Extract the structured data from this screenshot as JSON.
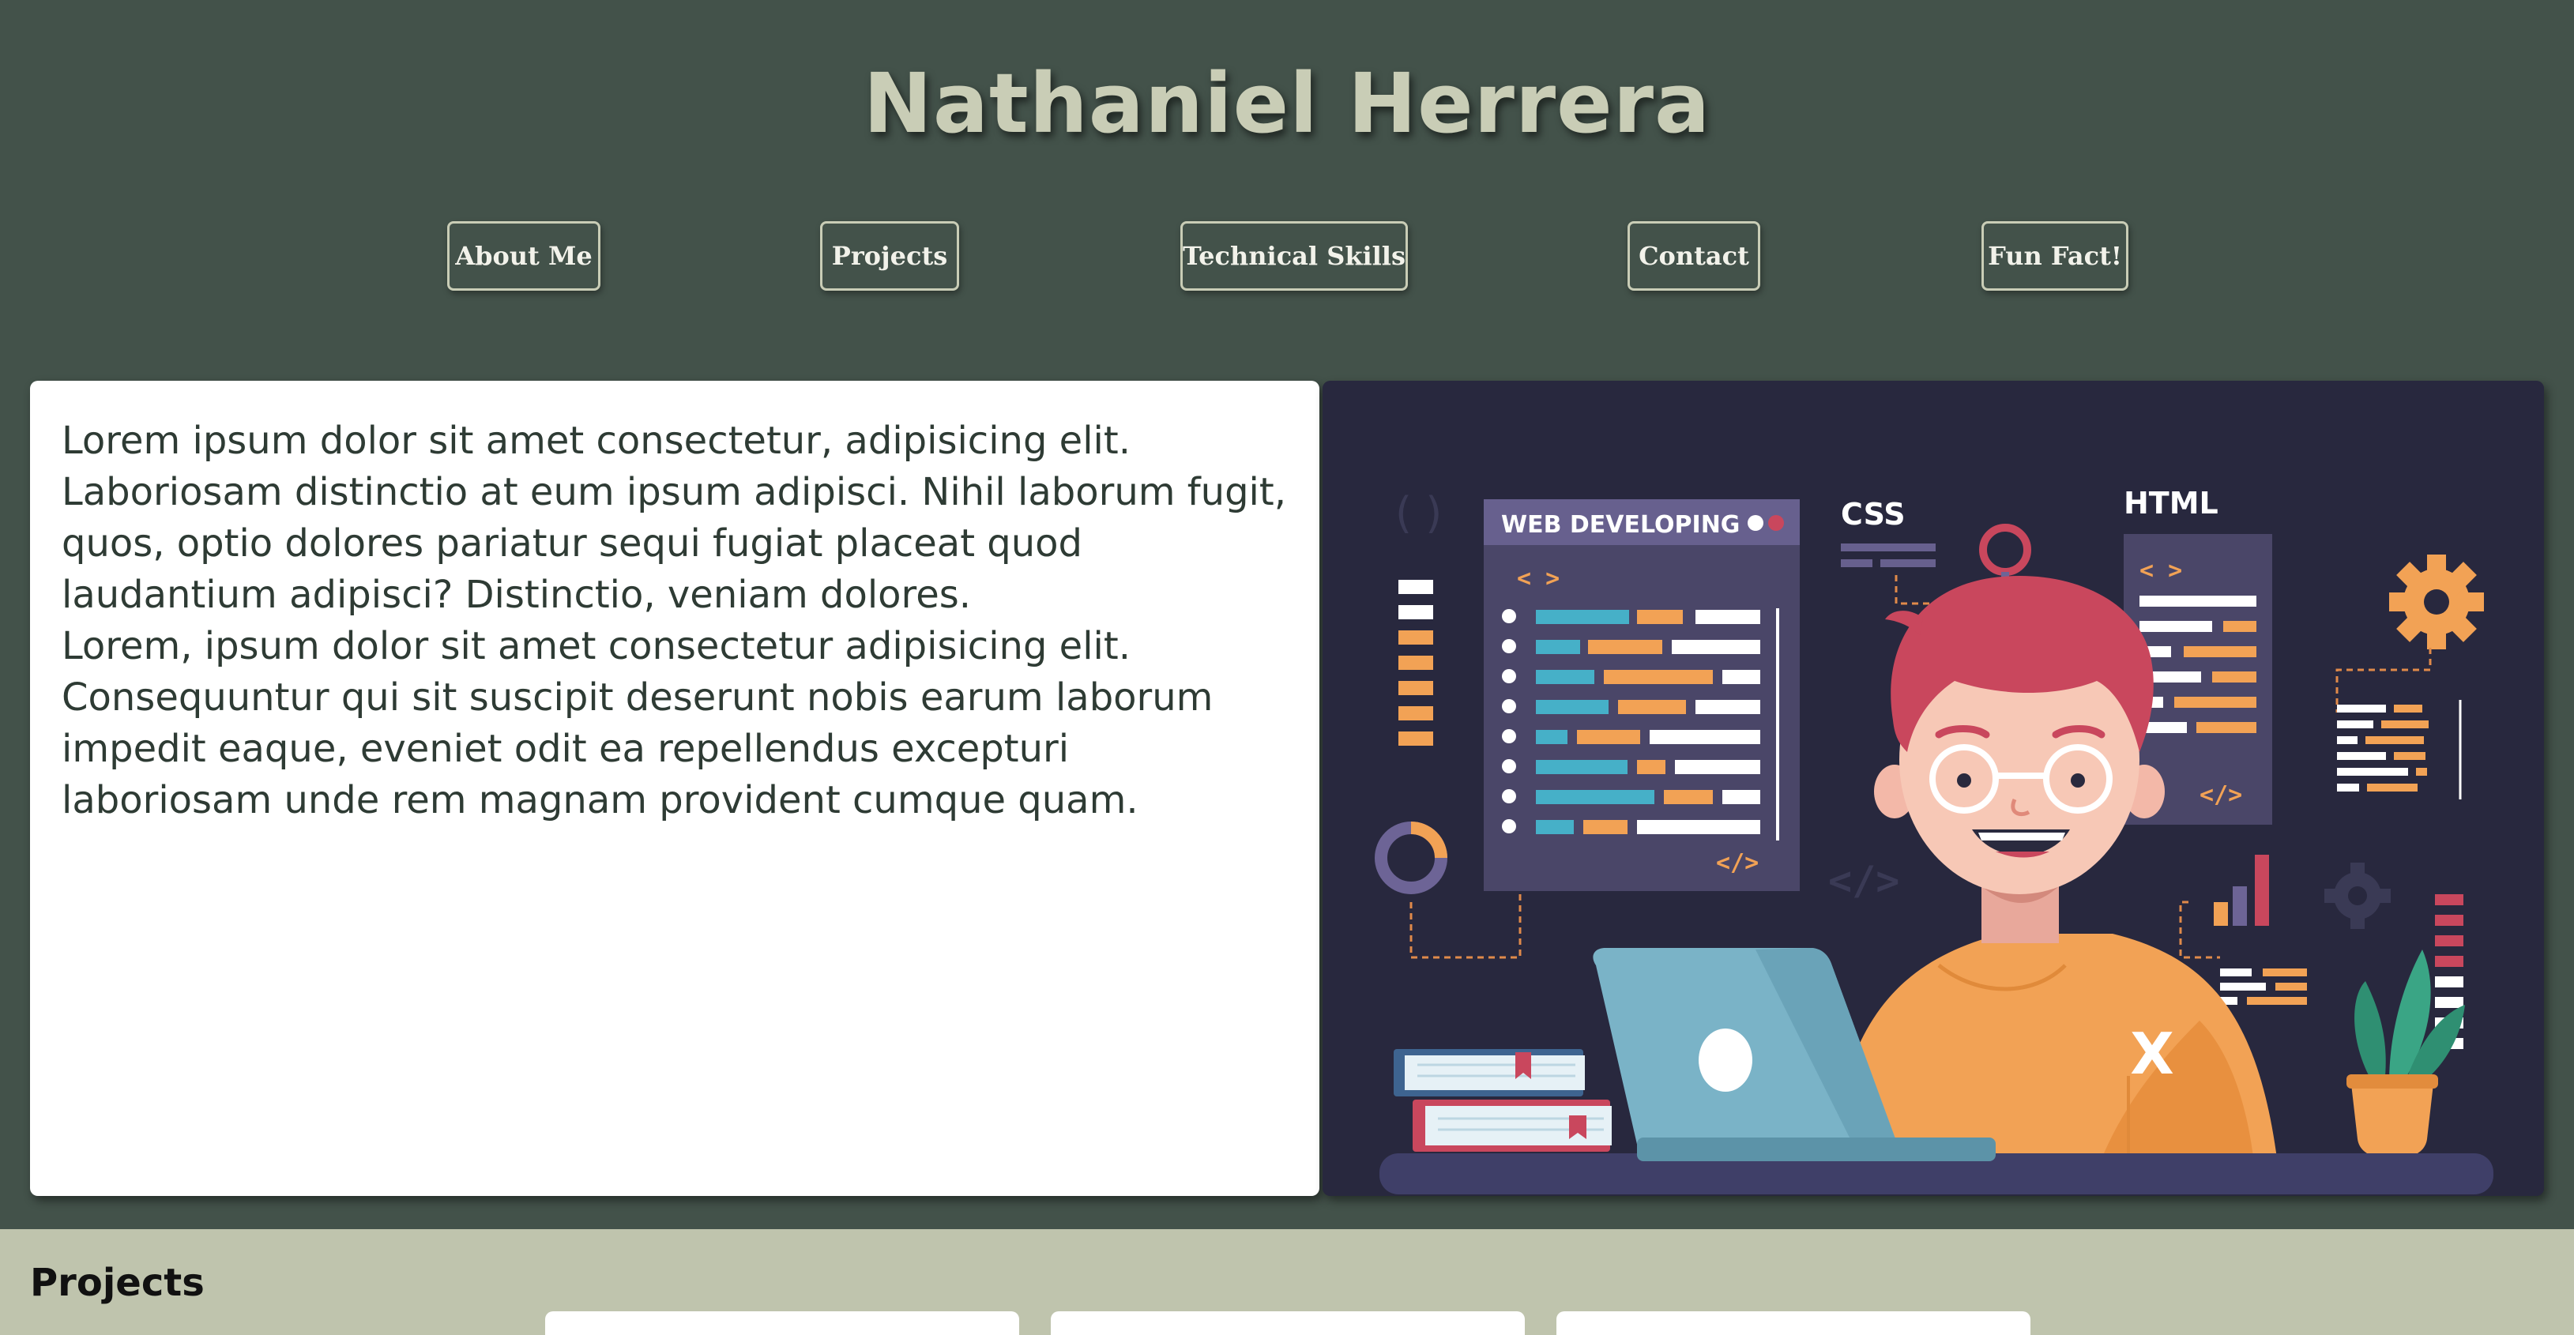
{
  "header": {
    "title": "Nathaniel Herrera",
    "nav": [
      {
        "label": "About Me"
      },
      {
        "label": "Projects"
      },
      {
        "label": "Technical Skills"
      },
      {
        "label": "Contact"
      },
      {
        "label": "Fun Fact!"
      }
    ]
  },
  "about": {
    "paragraph1": "Lorem ipsum dolor sit amet consectetur, adipisicing elit. Laboriosam distinctio at eum ipsum adipisci. Nihil laborum fugit, quos, optio dolores pariatur sequi fugiat placeat quod laudantium adipisci? Distinctio, veniam dolores.",
    "paragraph2": "Lorem, ipsum dolor sit amet consectetur adipisicing elit. Consequuntur qui sit suscipit deserunt nobis earum laborum impedit eaque, eveniet odit ea repellendus excepturi laboriosam unde rem magnam provident cumque quam."
  },
  "hero": {
    "panel_title": "WEB DEVELOPING",
    "code_open": "< >",
    "code_close": "</>",
    "css_label": "CSS",
    "html_label": "HTML",
    "shirt_mark": "X"
  },
  "projects": {
    "heading": "Projects"
  },
  "colors": {
    "background": "#43524a",
    "title": "#c9cdb6",
    "projects_bg": "#bfc4ad",
    "hero_bg": "#28283e",
    "accent_orange": "#f2a255",
    "accent_teal": "#46b0c8",
    "accent_red": "#c9475d"
  }
}
